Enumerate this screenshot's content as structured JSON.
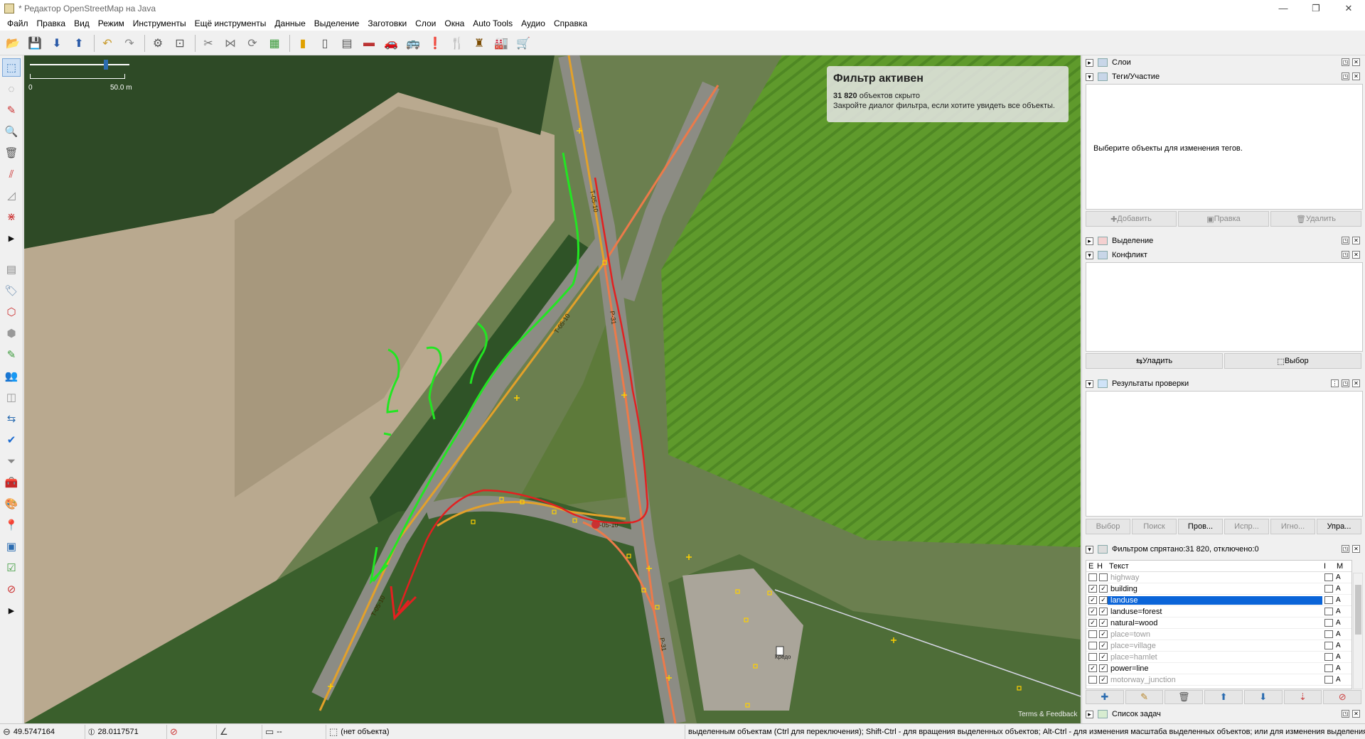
{
  "window": {
    "title": "* Редактор OpenStreetMap на Java",
    "minimize": "—",
    "maximize": "❐",
    "close": "✕"
  },
  "menu": [
    "Файл",
    "Правка",
    "Вид",
    "Режим",
    "Инструменты",
    "Ещё инструменты",
    "Данные",
    "Выделение",
    "Заготовки",
    "Слои",
    "Окна",
    "Auto Tools",
    "Аудио",
    "Справка"
  ],
  "map": {
    "scale_left": "0",
    "scale_right": "50.0 m",
    "terms": "Terms & Feedback",
    "road_labels": [
      "Т-05-10",
      "Т-05-10",
      "Р-31",
      "Т-05-10",
      "Р-31",
      "Т-05-10",
      "Р-31"
    ],
    "poi_label": "Кредо",
    "filter": {
      "title": "Фильтр активен",
      "count": "31 820",
      "count_suffix": " объектов скрыто",
      "hint": "Закройте диалог фильтра, если хотите увидеть все объекты."
    }
  },
  "panels": {
    "layers": {
      "title": "Слои"
    },
    "tags": {
      "title": "Теги/Участие",
      "empty": "Выберите объекты для изменения тегов.",
      "add": "Добавить",
      "edit": "Правка",
      "delete": "Удалить"
    },
    "selection": {
      "title": "Выделение"
    },
    "conflict": {
      "title": "Конфликт",
      "resolve": "Уладить",
      "select": "Выбор"
    },
    "validation": {
      "title": "Результаты проверки",
      "buttons": [
        "Выбор",
        "Поиск",
        "Пров...",
        "Испр...",
        "Игно...",
        "Упра..."
      ]
    },
    "filter": {
      "title": "Фильтром спрятано:31 820, отключено:0",
      "col_e": "E",
      "col_h": "H",
      "col_text": "Текст",
      "col_i": "I",
      "col_m": "M",
      "rows": [
        {
          "text": "highway",
          "e": false,
          "h": false,
          "mode": "A",
          "enabled": false
        },
        {
          "text": "building",
          "e": true,
          "h": true,
          "mode": "A",
          "enabled": true
        },
        {
          "text": "landuse",
          "e": true,
          "h": true,
          "mode": "A",
          "enabled": true,
          "selected": true
        },
        {
          "text": "landuse=forest",
          "e": true,
          "h": true,
          "mode": "A",
          "enabled": true
        },
        {
          "text": "natural=wood",
          "e": true,
          "h": true,
          "mode": "A",
          "enabled": true
        },
        {
          "text": "place=town",
          "e": false,
          "h": true,
          "mode": "A",
          "enabled": false
        },
        {
          "text": "place=village",
          "e": false,
          "h": true,
          "mode": "A",
          "enabled": false
        },
        {
          "text": "place=hamlet",
          "e": false,
          "h": true,
          "mode": "A",
          "enabled": false
        },
        {
          "text": "power=line",
          "e": true,
          "h": true,
          "mode": "A",
          "enabled": true
        },
        {
          "text": "motorway_junction",
          "e": false,
          "h": true,
          "mode": "A",
          "enabled": false
        }
      ]
    },
    "tasks": {
      "title": "Список задач"
    }
  },
  "status": {
    "lat": "49.5747164",
    "lon": "28.0117571",
    "length": "--",
    "object": "(нет объекта)",
    "help": "выделенным объектам (Ctrl для переключения); Shift-Ctrl - для вращения выделенных объектов; Alt-Ctrl - для изменения масштаба выделенных объектов; или для изменения выделения"
  }
}
